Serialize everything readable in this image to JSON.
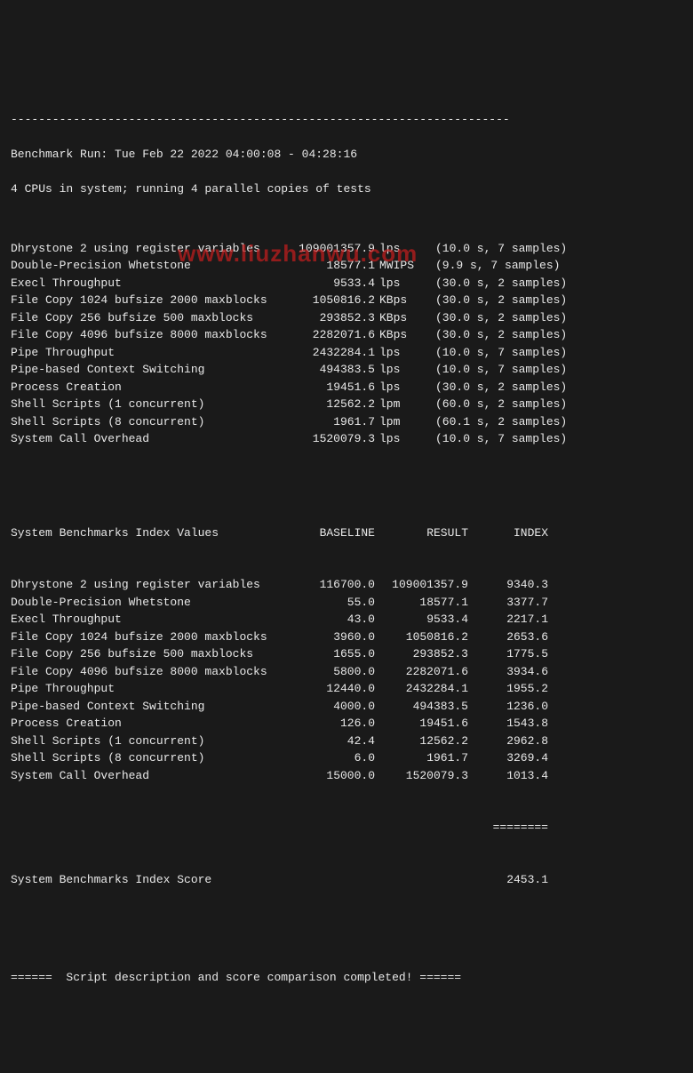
{
  "watermark": "www.liuzhanwu.com",
  "top_dashes": "------------------------------------------------------------------------",
  "header": {
    "run_line": "Benchmark Run: Tue Feb 22 2022 04:00:08 - 04:28:16",
    "cpu_line": "4 CPUs in system; running 4 parallel copies of tests"
  },
  "bench": [
    {
      "label": "Dhrystone 2 using register variables",
      "val": "109001357.9",
      "unit": "lps",
      "timing": "(10.0 s, 7 samples)"
    },
    {
      "label": "Double-Precision Whetstone",
      "val": "18577.1",
      "unit": "MWIPS",
      "timing": "(9.9 s, 7 samples)"
    },
    {
      "label": "Execl Throughput",
      "val": "9533.4",
      "unit": "lps",
      "timing": "(30.0 s, 2 samples)"
    },
    {
      "label": "File Copy 1024 bufsize 2000 maxblocks",
      "val": "1050816.2",
      "unit": "KBps",
      "timing": "(30.0 s, 2 samples)"
    },
    {
      "label": "File Copy 256 bufsize 500 maxblocks",
      "val": "293852.3",
      "unit": "KBps",
      "timing": "(30.0 s, 2 samples)"
    },
    {
      "label": "File Copy 4096 bufsize 8000 maxblocks",
      "val": "2282071.6",
      "unit": "KBps",
      "timing": "(30.0 s, 2 samples)"
    },
    {
      "label": "Pipe Throughput",
      "val": "2432284.1",
      "unit": "lps",
      "timing": "(10.0 s, 7 samples)"
    },
    {
      "label": "Pipe-based Context Switching",
      "val": "494383.5",
      "unit": "lps",
      "timing": "(10.0 s, 7 samples)"
    },
    {
      "label": "Process Creation",
      "val": "19451.6",
      "unit": "lps",
      "timing": "(30.0 s, 2 samples)"
    },
    {
      "label": "Shell Scripts (1 concurrent)",
      "val": "12562.2",
      "unit": "lpm",
      "timing": "(60.0 s, 2 samples)"
    },
    {
      "label": "Shell Scripts (8 concurrent)",
      "val": "1961.7",
      "unit": "lpm",
      "timing": "(60.1 s, 2 samples)"
    },
    {
      "label": "System Call Overhead",
      "val": "1520079.3",
      "unit": "lps",
      "timing": "(10.0 s, 7 samples)"
    }
  ],
  "idx_header": {
    "label": "System Benchmarks Index Values",
    "baseline": "BASELINE",
    "result": "RESULT",
    "index": "INDEX"
  },
  "idx": [
    {
      "label": "Dhrystone 2 using register variables",
      "baseline": "116700.0",
      "result": "109001357.9",
      "index": "9340.3"
    },
    {
      "label": "Double-Precision Whetstone",
      "baseline": "55.0",
      "result": "18577.1",
      "index": "3377.7"
    },
    {
      "label": "Execl Throughput",
      "baseline": "43.0",
      "result": "9533.4",
      "index": "2217.1"
    },
    {
      "label": "File Copy 1024 bufsize 2000 maxblocks",
      "baseline": "3960.0",
      "result": "1050816.2",
      "index": "2653.6"
    },
    {
      "label": "File Copy 256 bufsize 500 maxblocks",
      "baseline": "1655.0",
      "result": "293852.3",
      "index": "1775.5"
    },
    {
      "label": "File Copy 4096 bufsize 8000 maxblocks",
      "baseline": "5800.0",
      "result": "2282071.6",
      "index": "3934.6"
    },
    {
      "label": "Pipe Throughput",
      "baseline": "12440.0",
      "result": "2432284.1",
      "index": "1955.2"
    },
    {
      "label": "Pipe-based Context Switching",
      "baseline": "4000.0",
      "result": "494383.5",
      "index": "1236.0"
    },
    {
      "label": "Process Creation",
      "baseline": "126.0",
      "result": "19451.6",
      "index": "1543.8"
    },
    {
      "label": "Shell Scripts (1 concurrent)",
      "baseline": "42.4",
      "result": "12562.2",
      "index": "2962.8"
    },
    {
      "label": "Shell Scripts (8 concurrent)",
      "baseline": "6.0",
      "result": "1961.7",
      "index": "3269.4"
    },
    {
      "label": "System Call Overhead",
      "baseline": "15000.0",
      "result": "1520079.3",
      "index": "1013.4"
    }
  ],
  "underline": "========",
  "score": {
    "label": "System Benchmarks Index Score",
    "value": "2453.1"
  },
  "footer": "======  Script description and score comparison completed! ======"
}
